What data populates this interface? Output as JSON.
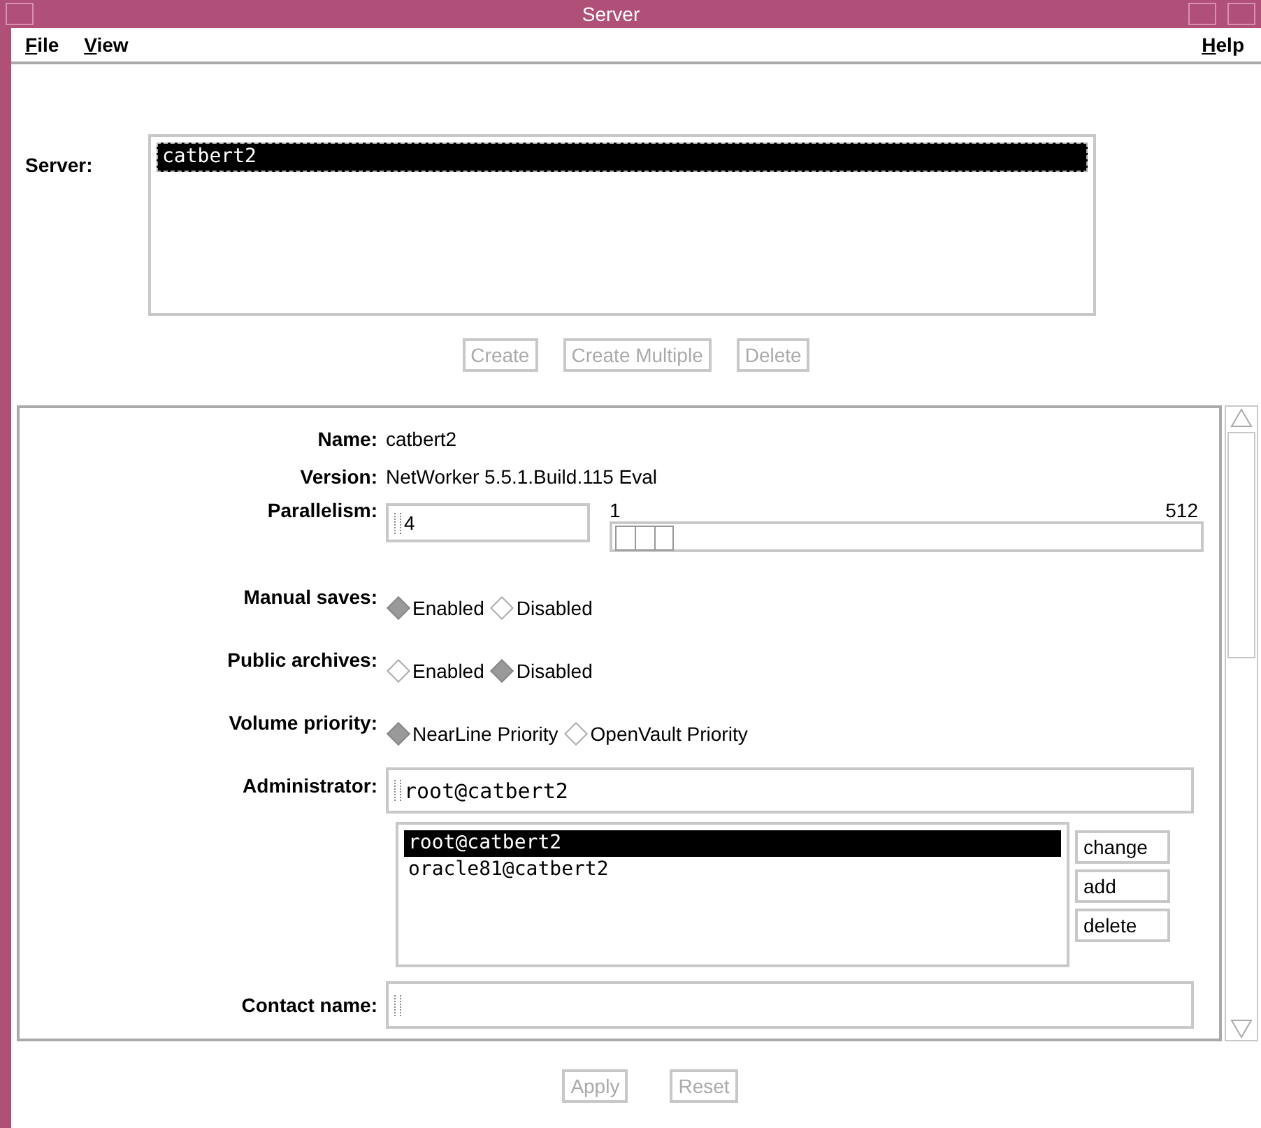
{
  "window": {
    "title": "Server"
  },
  "menu": [
    {
      "label": "File",
      "mnemonic": true
    },
    {
      "label": "View",
      "mnemonic": true
    },
    {
      "label": "Help",
      "mnemonic": true
    }
  ],
  "server": {
    "label": "Server:",
    "items": [
      {
        "text": "catbert2",
        "selected": true
      }
    ]
  },
  "server_buttons": [
    {
      "label": "Create",
      "disabled": true
    },
    {
      "label": "Create Multiple",
      "disabled": true
    },
    {
      "label": "Delete",
      "disabled": true
    }
  ],
  "form": {
    "name": {
      "label": "Name:",
      "value": "catbert2"
    },
    "version": {
      "label": "Version:",
      "value": "NetWorker 5.5.1.Build.115 Eval"
    },
    "parallelism": {
      "label": "Parallelism:",
      "value": "4",
      "min": "1",
      "max": "512",
      "level": 0.006
    },
    "radios": [
      {
        "label": "Manual saves:",
        "options": [
          {
            "label": "Enabled",
            "selected": true
          },
          {
            "label": "Disabled",
            "selected": false
          }
        ]
      },
      {
        "label": "Public archives:",
        "options": [
          {
            "label": "Enabled",
            "selected": false
          },
          {
            "label": "Disabled",
            "selected": true
          }
        ]
      },
      {
        "label": "Volume priority:",
        "options": [
          {
            "label": "NearLine Priority",
            "selected": true
          },
          {
            "label": "OpenVault Priority",
            "selected": false
          }
        ]
      }
    ],
    "administrator": {
      "label": "Administrator:",
      "value": "root@catbert2",
      "items": [
        {
          "text": "root@catbert2",
          "selected": true
        },
        {
          "text": "oracle81@catbert2",
          "selected": false
        }
      ],
      "buttons": [
        "change",
        "add",
        "delete"
      ]
    },
    "contact": {
      "label": "Contact name:"
    }
  },
  "bottom_buttons": [
    {
      "label": "Apply",
      "disabled": true
    },
    {
      "label": "Reset",
      "disabled": true
    }
  ]
}
